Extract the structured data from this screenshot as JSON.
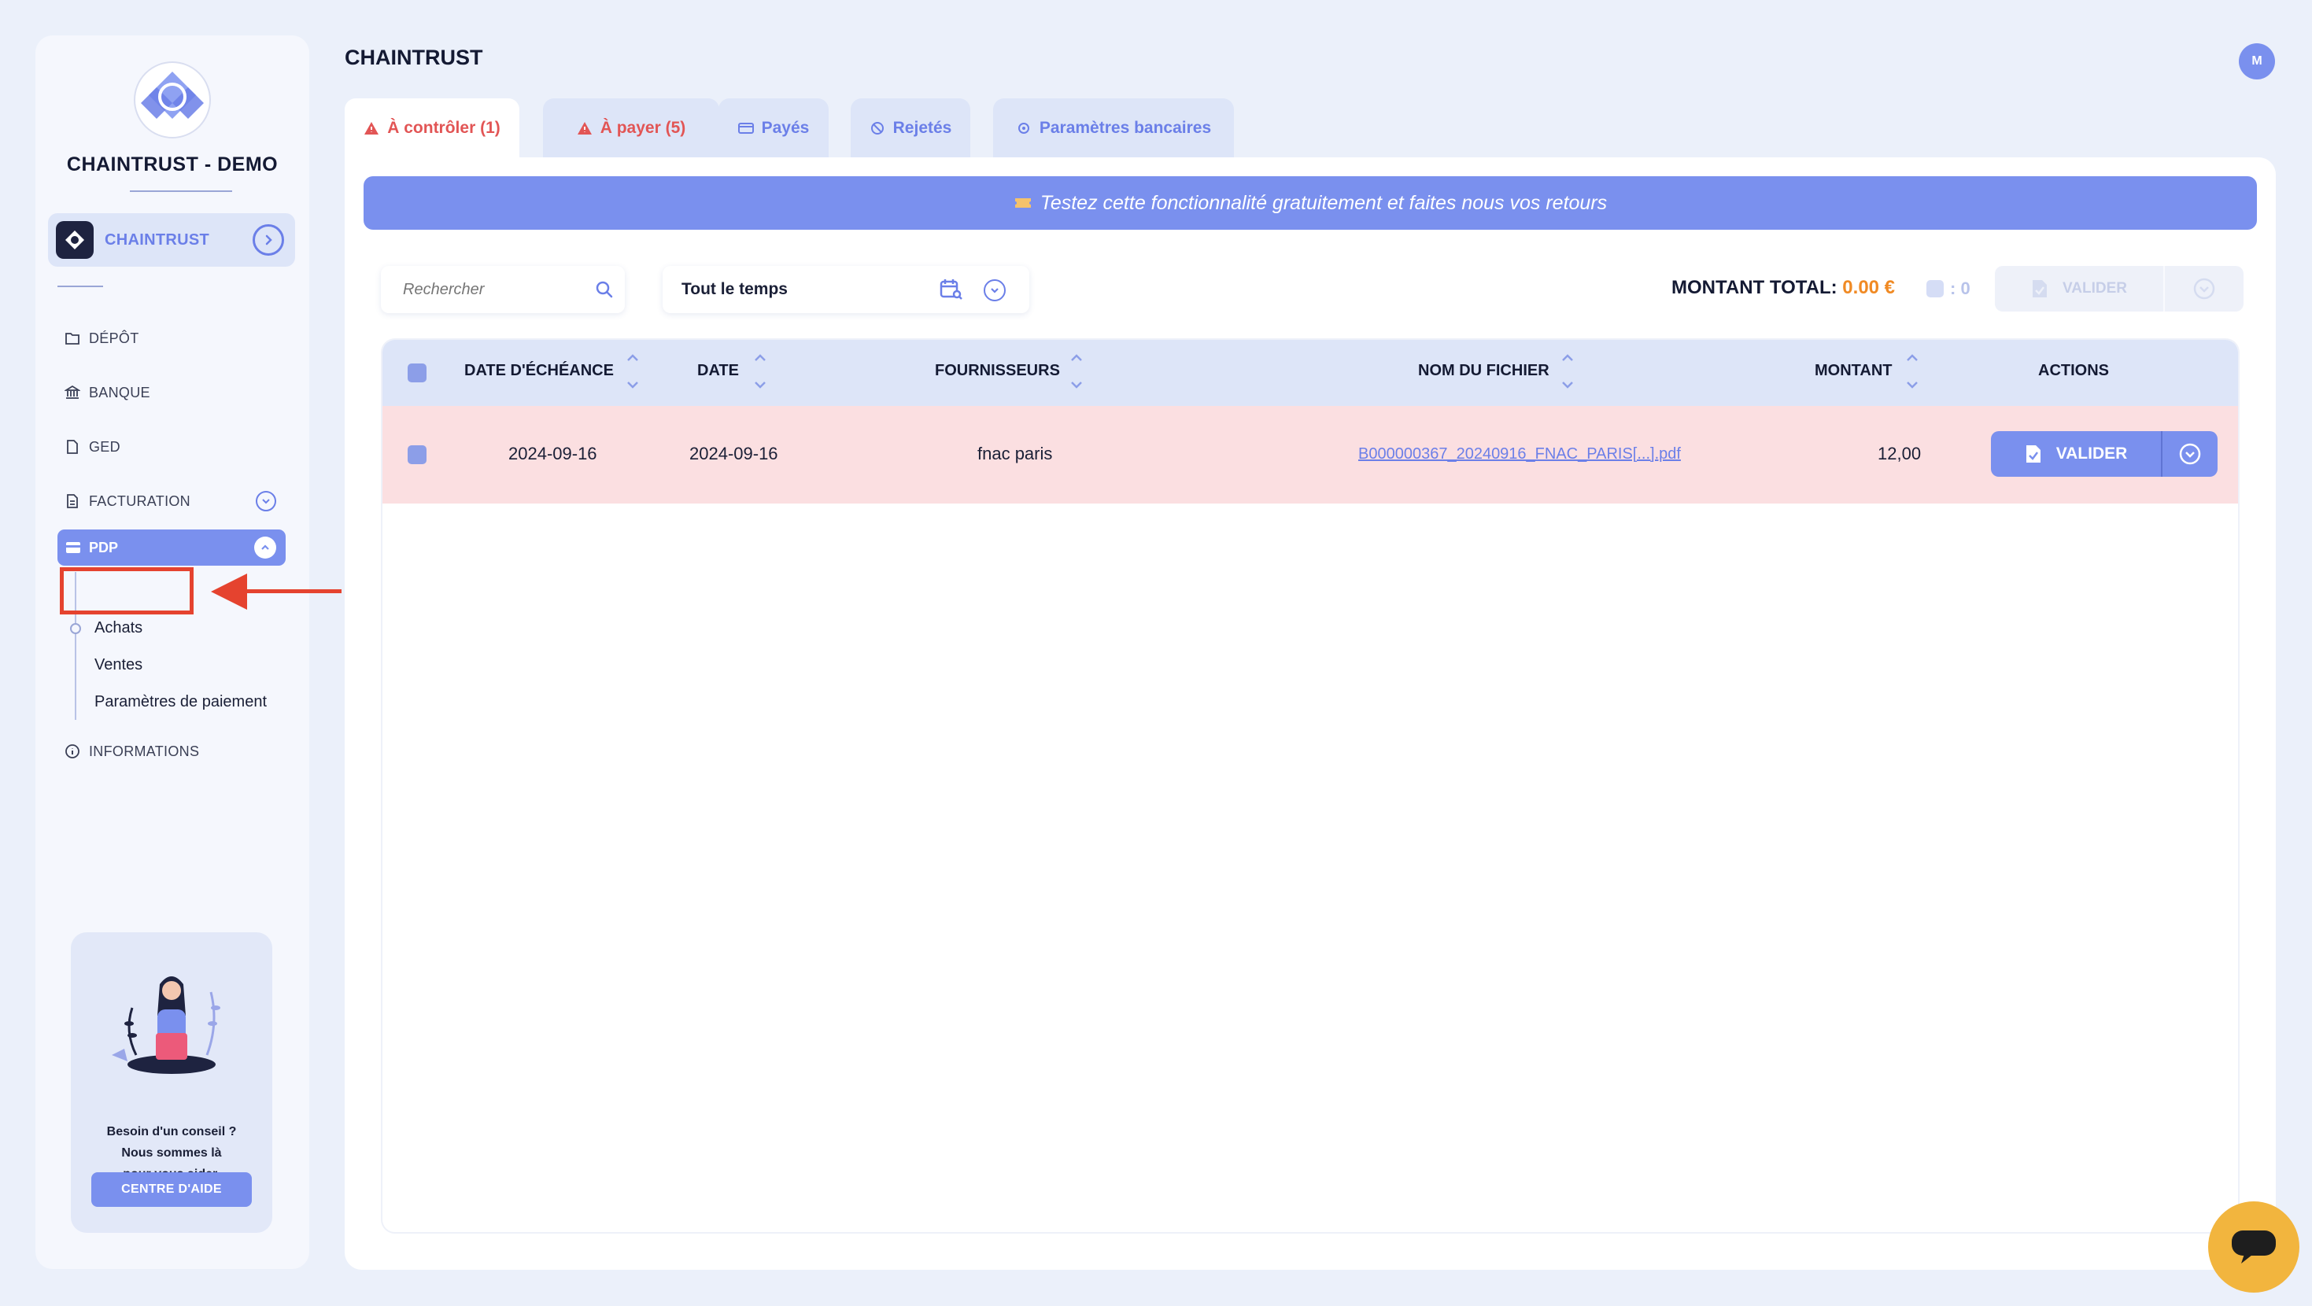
{
  "sidebar": {
    "company_name": "CHAINTRUST - DEMO",
    "org_label": "CHAINTRUST",
    "nav": {
      "depot": "DÉPÔT",
      "banque": "BANQUE",
      "ged": "GED",
      "facturation": "FACTURATION",
      "pdp": "PDP",
      "informations": "INFORMATIONS"
    },
    "pdp_sub": [
      "Achats",
      "Ventes",
      "Paramètres de paiement"
    ],
    "help": {
      "line1": "Besoin d'un conseil ?",
      "line2": "Nous sommes là",
      "line3": "pour vous aider.",
      "button": "CENTRE D'AIDE"
    }
  },
  "header": {
    "title": "CHAINTRUST",
    "avatar_initial": "M"
  },
  "tabs": [
    {
      "label": "À contrôler (1)",
      "icon": "warning-icon",
      "active": true
    },
    {
      "label": "À payer (5)",
      "icon": "warning-icon",
      "active": false
    },
    {
      "label": "Payés",
      "icon": "payment-icon",
      "active": false
    },
    {
      "label": "Rejetés",
      "icon": "blocked-icon",
      "active": false
    },
    {
      "label": "Paramètres bancaires",
      "icon": "gear-icon",
      "active": false
    }
  ],
  "banner": {
    "text": "Testez cette fonctionnalité gratuitement et faites nous vos retours"
  },
  "toolbar": {
    "search_placeholder": "Rechercher",
    "period": "Tout le temps",
    "total_label": "MONTANT TOTAL:",
    "total_amount": "0.00 €",
    "selected_count": ": 0",
    "validate_label": "VALIDER"
  },
  "table": {
    "headers": [
      "DATE D'ÉCHÉANCE",
      "DATE",
      "FOURNISSEURS",
      "NOM DU FICHIER",
      "MONTANT",
      "ACTIONS"
    ],
    "rows": [
      {
        "due_date": "2024-09-16",
        "date": "2024-09-16",
        "supplier": "fnac paris",
        "file_name": "B000000367_20240916_FNAC_PARIS[...].pdf",
        "amount": "12,00",
        "action": "VALIDER"
      }
    ]
  },
  "colors": {
    "accent": "#7a90ee",
    "alert": "#e25555",
    "total_amount": "#f08a24",
    "row_highlight": "#fbdfe1",
    "annotation": "#e5432f",
    "chat": "#f2b53e"
  }
}
